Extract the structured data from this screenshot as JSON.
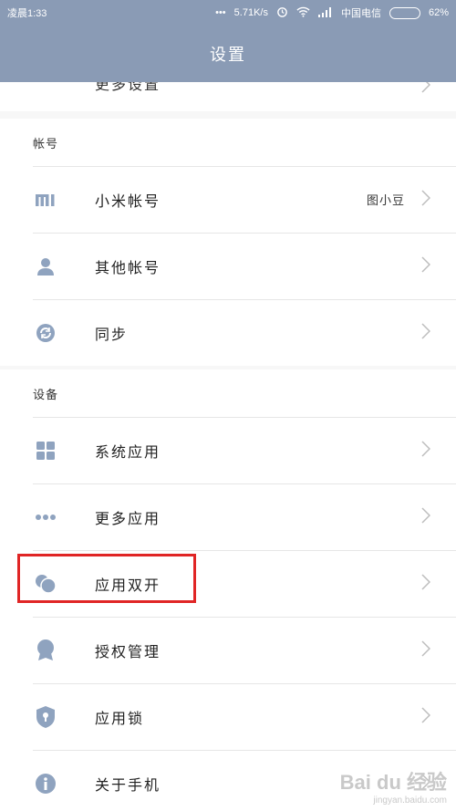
{
  "status_bar": {
    "time": "凌晨1:33",
    "network_speed": "5.71K/s",
    "carrier": "中国电信",
    "battery": "62%",
    "battery_level": 0.62
  },
  "header": {
    "title": "设置"
  },
  "partial_item": {
    "label": "更多设置"
  },
  "account_section": {
    "title": "帐号",
    "items": [
      {
        "label": "小米帐号",
        "value": "图小豆",
        "icon": "mi-logo-icon"
      },
      {
        "label": "其他帐号",
        "icon": "person-icon"
      },
      {
        "label": "同步",
        "icon": "sync-icon"
      }
    ]
  },
  "device_section": {
    "title": "设备",
    "items": [
      {
        "label": "系统应用",
        "icon": "grid-icon"
      },
      {
        "label": "更多应用",
        "icon": "more-dots-icon"
      },
      {
        "label": "应用双开",
        "icon": "dual-app-icon"
      },
      {
        "label": "授权管理",
        "icon": "badge-icon"
      },
      {
        "label": "应用锁",
        "icon": "shield-lock-icon"
      },
      {
        "label": "关于手机",
        "icon": "info-icon"
      }
    ]
  },
  "watermark": {
    "main": "Bai du 经验",
    "sub": "jingyan.baidu.com"
  },
  "colors": {
    "header": "#8a9bb5",
    "icon": "#8fa3bf",
    "highlight": "#e02525",
    "chevron": "#bdbdbd"
  }
}
